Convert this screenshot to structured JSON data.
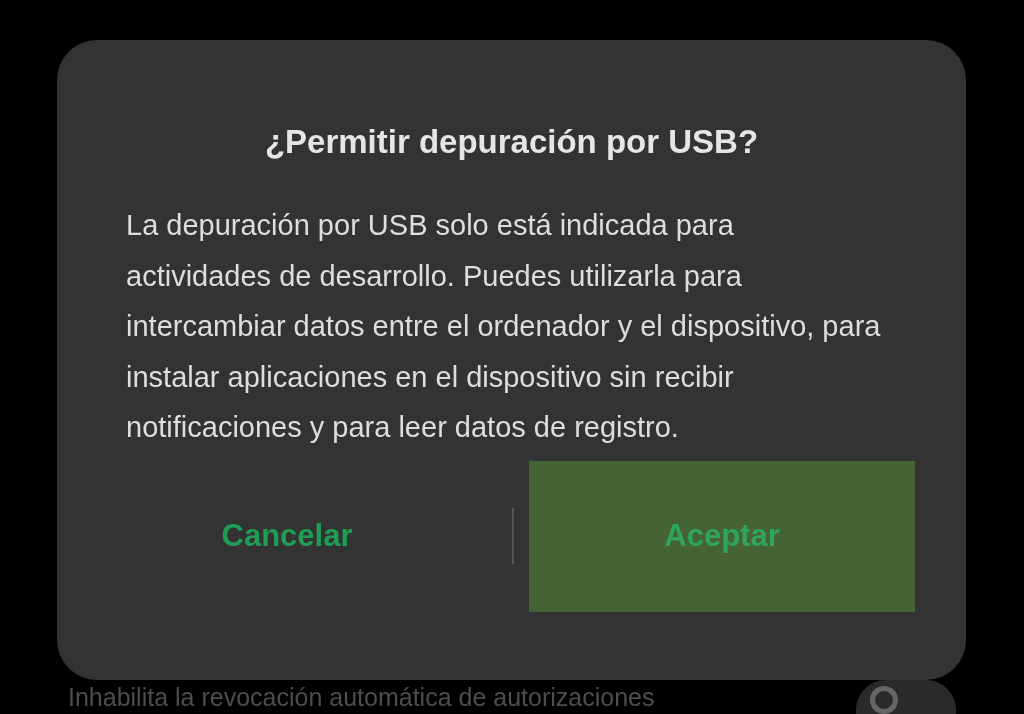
{
  "dialog": {
    "title": "¿Permitir depuración por USB?",
    "message": "La depuración por USB solo está indicada para actividades de desarrollo. Puedes utilizarla para intercambiar datos entre el ordenador y el dispositivo, para instalar aplicaciones en el dispositivo sin recibir notificaciones y para leer datos de registro.",
    "buttons": [
      {
        "label": "Cancelar",
        "selected": false
      },
      {
        "label": "Aceptar",
        "selected": true
      }
    ]
  },
  "background_setting": {
    "label": "Inhabilita la revocación automática de autorizaciones",
    "on": false
  }
}
